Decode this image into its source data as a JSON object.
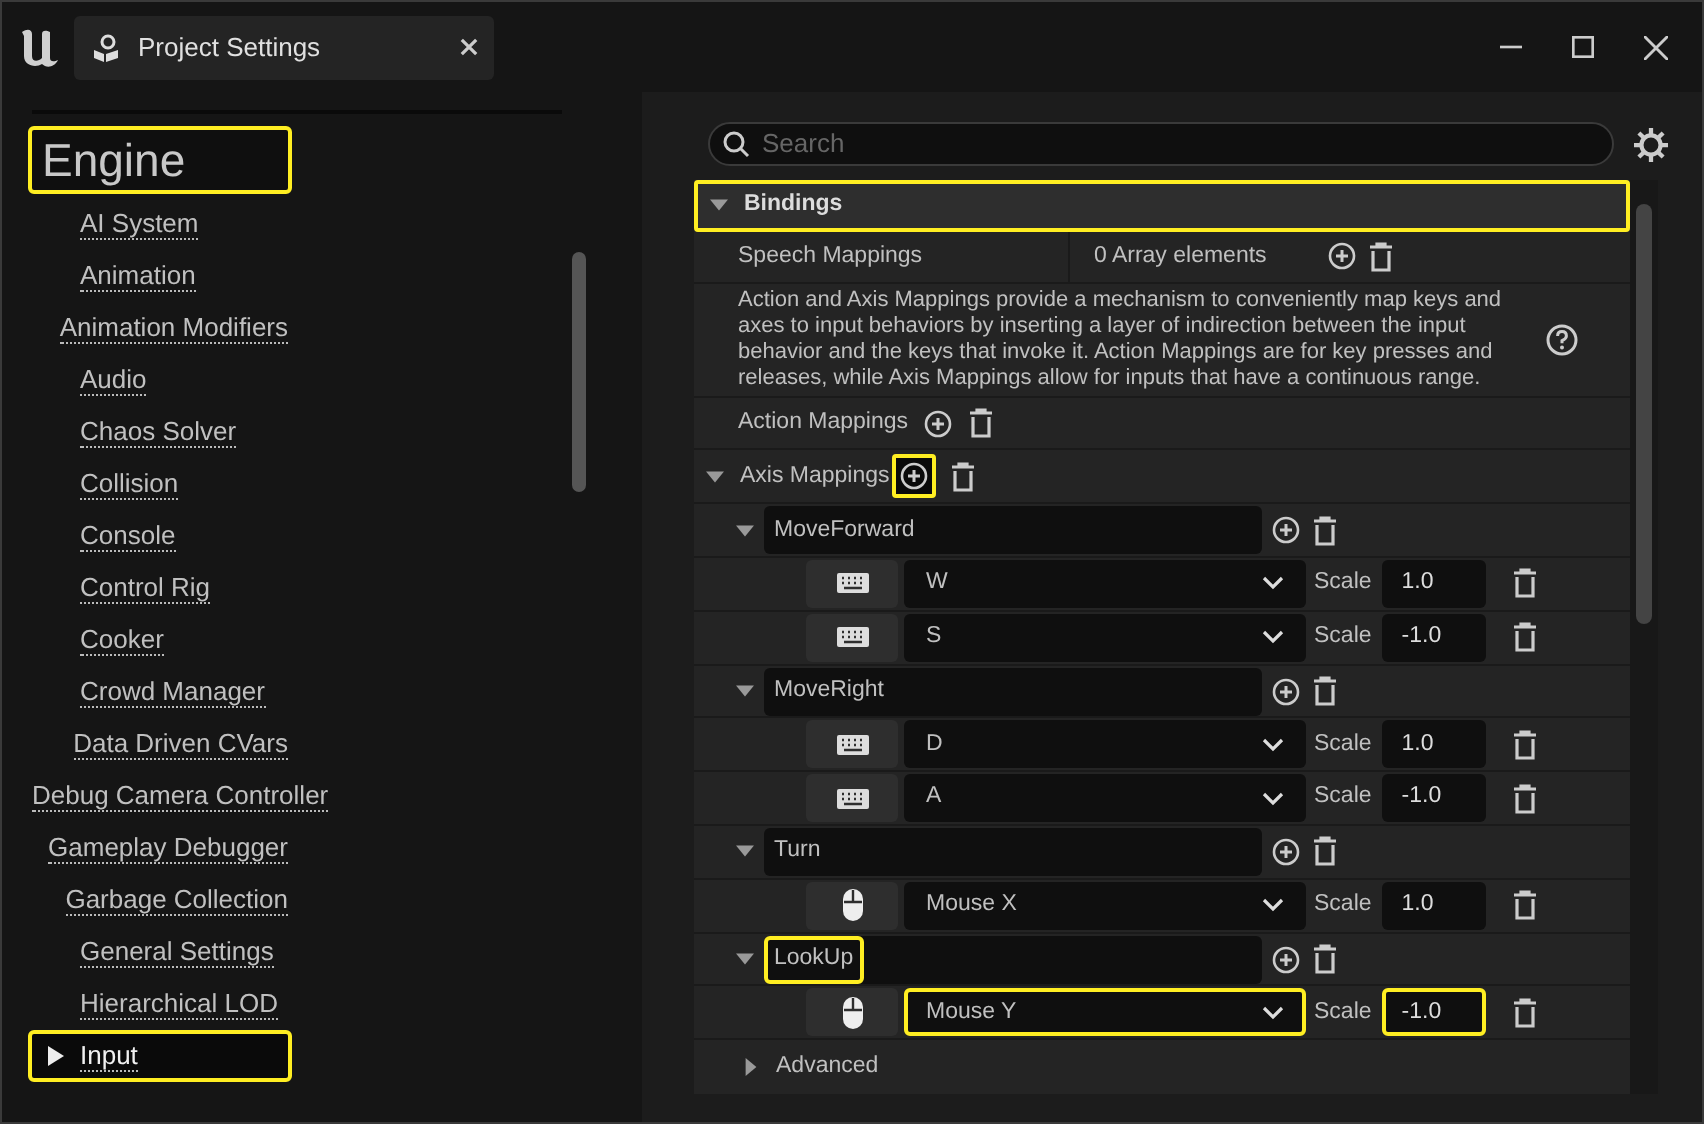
{
  "window": {
    "tab_title": "Project Settings"
  },
  "sidebar": {
    "heading": "Engine",
    "heading_highlighted": true,
    "items": [
      {
        "label": "AI System",
        "selected": false,
        "highlighted": false
      },
      {
        "label": "Animation",
        "selected": false,
        "highlighted": false
      },
      {
        "label": "Animation Modifiers",
        "selected": false,
        "highlighted": false
      },
      {
        "label": "Audio",
        "selected": false,
        "highlighted": false
      },
      {
        "label": "Chaos Solver",
        "selected": false,
        "highlighted": false
      },
      {
        "label": "Collision",
        "selected": false,
        "highlighted": false
      },
      {
        "label": "Console",
        "selected": false,
        "highlighted": false
      },
      {
        "label": "Control Rig",
        "selected": false,
        "highlighted": false
      },
      {
        "label": "Cooker",
        "selected": false,
        "highlighted": false
      },
      {
        "label": "Crowd Manager",
        "selected": false,
        "highlighted": false
      },
      {
        "label": "Data Driven CVars",
        "selected": false,
        "highlighted": false
      },
      {
        "label": "Debug Camera Controller",
        "selected": false,
        "highlighted": false
      },
      {
        "label": "Gameplay Debugger",
        "selected": false,
        "highlighted": false
      },
      {
        "label": "Garbage Collection",
        "selected": false,
        "highlighted": false
      },
      {
        "label": "General Settings",
        "selected": false,
        "highlighted": false
      },
      {
        "label": "Hierarchical LOD",
        "selected": false,
        "highlighted": false
      },
      {
        "label": "Input",
        "selected": true,
        "highlighted": true
      }
    ]
  },
  "search": {
    "placeholder": "Search"
  },
  "section": {
    "title": "Bindings",
    "expanded": true,
    "highlighted": true
  },
  "speech_mappings": {
    "label": "Speech Mappings",
    "value": "0 Array elements"
  },
  "description": "Action and Axis Mappings provide a mechanism to conveniently map keys and axes to input behaviors by inserting a layer of indirection between the input behavior and the keys that invoke it. Action Mappings are for key presses and releases, while Axis Mappings allow for inputs that have a continuous range.",
  "action_mappings": {
    "label": "Action Mappings"
  },
  "axis_mappings": {
    "label": "Axis Mappings",
    "expanded": true,
    "add_highlighted": true,
    "groups": [
      {
        "name": "MoveForward",
        "expanded": true,
        "highlighted": false,
        "keys": [
          {
            "kind": "keyboard",
            "key": "W",
            "key_highlighted": false,
            "scale_label": "Scale",
            "scale": "1.0",
            "scale_highlighted": false
          },
          {
            "kind": "keyboard",
            "key": "S",
            "key_highlighted": false,
            "scale_label": "Scale",
            "scale": "-1.0",
            "scale_highlighted": false
          }
        ]
      },
      {
        "name": "MoveRight",
        "expanded": true,
        "highlighted": false,
        "keys": [
          {
            "kind": "keyboard",
            "key": "D",
            "key_highlighted": false,
            "scale_label": "Scale",
            "scale": "1.0",
            "scale_highlighted": false
          },
          {
            "kind": "keyboard",
            "key": "A",
            "key_highlighted": false,
            "scale_label": "Scale",
            "scale": "-1.0",
            "scale_highlighted": false
          }
        ]
      },
      {
        "name": "Turn",
        "expanded": true,
        "highlighted": false,
        "keys": [
          {
            "kind": "mouse",
            "key": "Mouse X",
            "key_highlighted": false,
            "scale_label": "Scale",
            "scale": "1.0",
            "scale_highlighted": false
          }
        ]
      },
      {
        "name": "LookUp",
        "expanded": true,
        "highlighted": true,
        "keys": [
          {
            "kind": "mouse",
            "key": "Mouse Y",
            "key_highlighted": true,
            "scale_label": "Scale",
            "scale": "-1.0",
            "scale_highlighted": true
          }
        ]
      }
    ]
  },
  "advanced": {
    "label": "Advanced",
    "expanded": false
  }
}
